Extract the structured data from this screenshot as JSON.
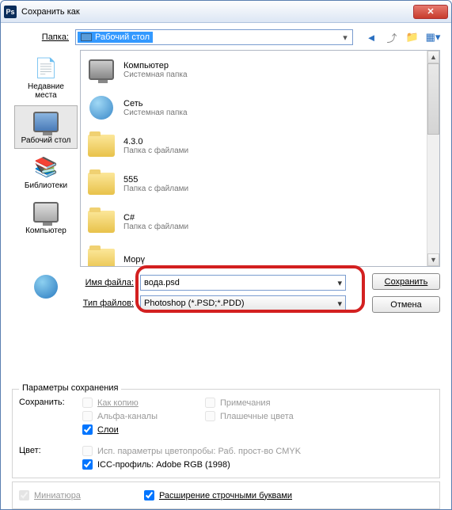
{
  "titlebar": {
    "title": "Сохранить как",
    "app": "Ps"
  },
  "folder_label": "Папка:",
  "folder_value": "Рабочий стол",
  "sidebar": [
    {
      "label": "Недавние места",
      "icon": "recent"
    },
    {
      "label": "Рабочий стол",
      "icon": "desktop",
      "selected": true
    },
    {
      "label": "Библиотеки",
      "icon": "libraries"
    },
    {
      "label": "Компьютер",
      "icon": "computer"
    }
  ],
  "files": [
    {
      "name": "Компьютер",
      "sub": "Системная папка",
      "icon": "computer"
    },
    {
      "name": "Сеть",
      "sub": "Системная папка",
      "icon": "network"
    },
    {
      "name": "4.3.0",
      "sub": "Папка с файлами",
      "icon": "folder"
    },
    {
      "name": "555",
      "sub": "Папка с файлами",
      "icon": "folder"
    },
    {
      "name": "C#",
      "sub": "Папка с файлами",
      "icon": "folder"
    },
    {
      "name": "Морү",
      "sub": "",
      "icon": "folder"
    }
  ],
  "filename_label": "Имя файла:",
  "filename_value": "вода.psd",
  "filetype_label": "Тип файлов:",
  "filetype_value": "Photoshop (*.PSD;*.PDD)",
  "save_btn": "Сохранить",
  "cancel_btn": "Отмена",
  "params_legend": "Параметры сохранения",
  "save_label": "Сохранить:",
  "chk_copy": "Как копию",
  "chk_alpha": "Альфа-каналы",
  "chk_layers": "Слои",
  "chk_notes": "Примечания",
  "chk_spot": "Плашечные цвета",
  "color_label": "Цвет:",
  "chk_cmyk": "Исп. параметры цветопробы:  Раб. прост-во CMYK",
  "chk_icc": "ICC-профиль:  Adobe RGB (1998)",
  "chk_thumb": "Миниатюра",
  "chk_lowercase": "Расширение строчными буквами"
}
